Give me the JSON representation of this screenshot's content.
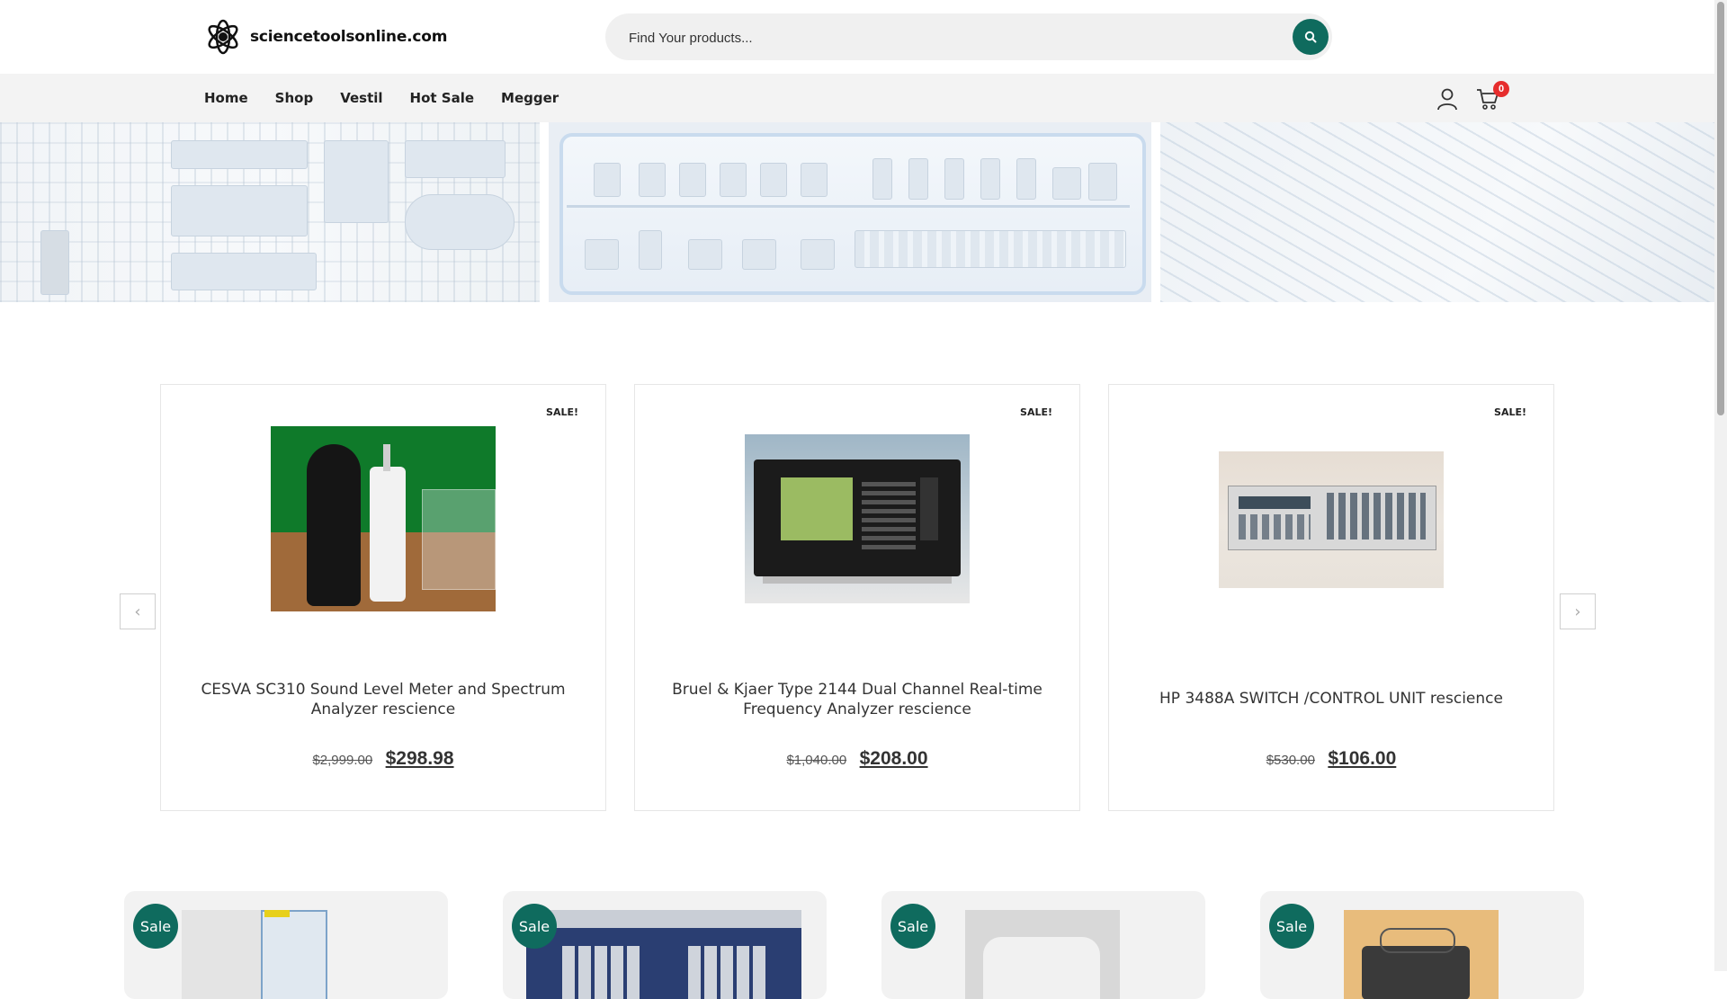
{
  "header": {
    "logo_text": "sciencetoolsonline.com",
    "search_placeholder": "Find Your products...",
    "search_icon": "search-icon"
  },
  "nav": {
    "items": [
      {
        "label": "Home"
      },
      {
        "label": "Shop"
      },
      {
        "label": "Vestil"
      },
      {
        "label": "Hot Sale"
      },
      {
        "label": "Megger"
      }
    ],
    "cart_count": "0"
  },
  "carousel": {
    "prev_icon": "chevron-left-icon",
    "next_icon": "chevron-right-icon",
    "products": [
      {
        "sale_label": "SALE!",
        "title": "CESVA SC310 Sound Level Meter and Spectrum Analyzer rescience",
        "old_price": "$2,999.00",
        "new_price": "$298.98"
      },
      {
        "sale_label": "SALE!",
        "title": "Bruel & Kjaer Type 2144 Dual Channel Real-time Frequency Analyzer rescience",
        "old_price": "$1,040.00",
        "new_price": "$208.00"
      },
      {
        "sale_label": "SALE!",
        "title": "HP 3488A SWITCH /CONTROL UNIT rescience",
        "old_price": "$530.00",
        "new_price": "$106.00"
      }
    ]
  },
  "grid": {
    "items": [
      {
        "sale_label": "Sale"
      },
      {
        "sale_label": "Sale"
      },
      {
        "sale_label": "Sale"
      },
      {
        "sale_label": "Sale"
      }
    ]
  },
  "colors": {
    "accent": "#0f6b5e",
    "badge": "#e62d2d",
    "nav_bg": "#f3f3f3"
  }
}
